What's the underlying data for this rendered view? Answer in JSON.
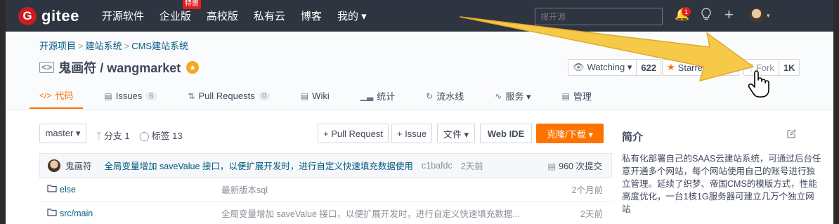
{
  "nav": {
    "logo": "gitee",
    "logo_badge": "G",
    "links": [
      "开源软件",
      "企业版",
      "高校版",
      "私有云",
      "博客",
      "我的 ▾"
    ],
    "hot_badge": "特惠",
    "search_placeholder": "搜开源",
    "notification_count": "1",
    "plus": "+",
    "caret": "▾"
  },
  "repo": {
    "breadcrumb": [
      "开源项目",
      "建站系统",
      "CMS建站系统"
    ],
    "breadcrumb_sep": ">",
    "title": "鬼画符 / wangmarket",
    "watch_label": "Watching ▾",
    "watch_count": "622",
    "star_label": "Starred",
    "fork_label": "Fork",
    "fork_count": "1K"
  },
  "tabs": [
    {
      "label": "代码",
      "icon": "</>"
    },
    {
      "label": "Issues",
      "count": "6"
    },
    {
      "label": "Pull Requests",
      "count": "0"
    },
    {
      "label": "Wiki"
    },
    {
      "label": "统计"
    },
    {
      "label": "流水线"
    },
    {
      "label": "服务 ▾"
    },
    {
      "label": "管理"
    }
  ],
  "toolbar": {
    "branch": "master ▾",
    "branches": "分支 1",
    "tags": "标签 13",
    "pull_request": "+ Pull Request",
    "issue": "+ Issue",
    "file": "文件 ▾",
    "web_ide": "Web IDE",
    "clone": "克隆/下载 ▾"
  },
  "commit": {
    "author": "鬼画符",
    "message": "全局变量增加 saveValue 接口，以便扩展开发时，进行自定义快速填充数据使用",
    "hash": "c1bafdc",
    "time": "2天前",
    "count": "960 次提交"
  },
  "files": [
    {
      "name": "else",
      "message": "最新版本sql",
      "time": "2个月前"
    },
    {
      "name": "src/main",
      "message": "全局变量增加 saveValue 接口，以便扩展开发时，进行自定义快速填充数据...",
      "time": "2天前"
    }
  ],
  "sidebar": {
    "title": "简介",
    "description": "私有化部署自己的SAAS云建站系统，可通过后台任意开通多个网站，每个网站使用自己的账号进行独立管理。延续了织梦、帝国CMS的模版方式，性能高度优化，一台1核1G服务器可建立几万个独立网站"
  },
  "colors": {
    "nav_bg": "#2e3440",
    "accent": "#fe7300",
    "link": "#005980",
    "arrow": "#f7c948"
  }
}
